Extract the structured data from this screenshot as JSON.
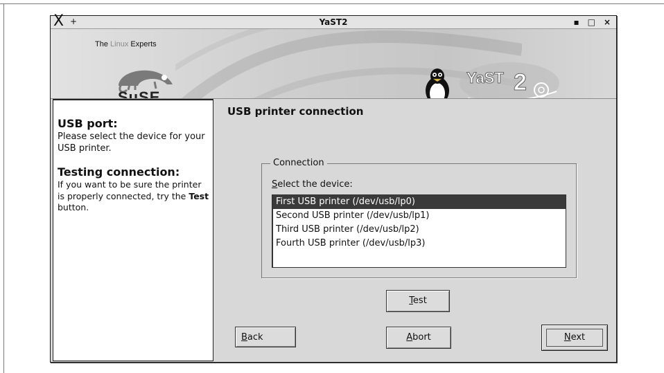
{
  "window": {
    "title": "YaST2",
    "menu_icon": "X",
    "pin_icon": "+",
    "minimize_icon": "▪",
    "maximize_icon": "□",
    "close_icon": "×"
  },
  "banner": {
    "tagline_pre": "The ",
    "tagline_linux": "Linux",
    "tagline_post": " Experts",
    "suse_word": "SuSE",
    "yast_word": "YaST"
  },
  "help": {
    "heading1": "USB port:",
    "text1": "Please select the device for your USB printer.",
    "heading2": "Testing connection:",
    "text2_pre": "If you want to be sure the printer is properly connected, try the ",
    "text2_bold": "Test",
    "text2_post": " button."
  },
  "main": {
    "title": "USB printer connection",
    "group_label": "Connection",
    "select_label_mn": "S",
    "select_label_rest": "elect the device:",
    "devices": [
      "First USB printer (/dev/usb/lp0)",
      "Second USB printer (/dev/usb/lp1)",
      "Third USB printer (/dev/usb/lp2)",
      "Fourth USB printer (/dev/usb/lp3)"
    ]
  },
  "buttons": {
    "test_mn": "T",
    "test_rest": "est",
    "back_mn": "B",
    "back_rest": "ack",
    "abort_mn": "A",
    "abort_rest": "bort",
    "next_mn": "N",
    "next_rest": "ext"
  }
}
